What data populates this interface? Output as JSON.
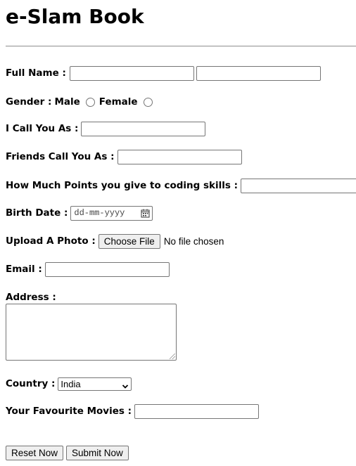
{
  "page": {
    "title": "e-Slam Book"
  },
  "form": {
    "full_name": {
      "label": "Full Name :",
      "first_value": "",
      "last_value": ""
    },
    "gender": {
      "label": "Gender :",
      "options": [
        "Male",
        "Female"
      ],
      "selected": null
    },
    "call_you_as": {
      "label": "I Call You As :",
      "value": ""
    },
    "friends_call": {
      "label": "Friends Call You As :",
      "value": ""
    },
    "coding_points": {
      "label": "How Much Points you give to coding skills :",
      "value": ""
    },
    "birth_date": {
      "label": "Birth Date :",
      "placeholder": "dd-mm-yyyy",
      "icon": "calendar-icon"
    },
    "photo": {
      "label": "Upload A Photo :",
      "button_label": "Choose File",
      "status": "No file chosen"
    },
    "email": {
      "label": "Email :",
      "value": ""
    },
    "address": {
      "label": "Address :",
      "value": ""
    },
    "country": {
      "label": "Country :",
      "selected": "India",
      "icon": "chevron-down-icon"
    },
    "movies": {
      "label": "Your Favourite Movies :",
      "value": ""
    }
  },
  "buttons": {
    "reset_label": "Reset Now",
    "submit_label": "Submit Now"
  }
}
